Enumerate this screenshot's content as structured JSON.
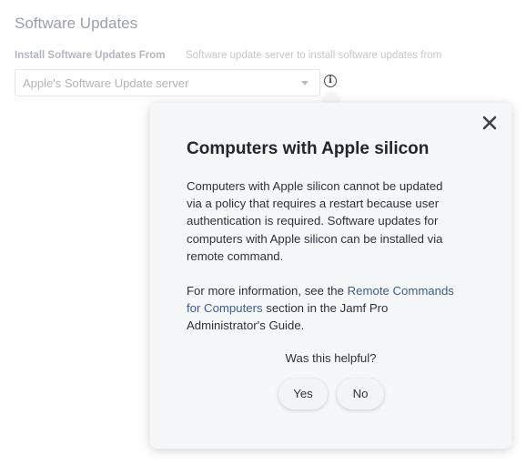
{
  "section": {
    "title": "Software Updates"
  },
  "field": {
    "label": "Install Software Updates From",
    "help": "Software update server to install software updates from",
    "selected_value": "Apple's Software Update server"
  },
  "icons": {
    "info": "info-icon",
    "close": "close-icon",
    "caret": "chevron-down-icon"
  },
  "popover": {
    "title": "Computers with Apple silicon",
    "body_lines": [
      "Computers with Apple silicon cannot be updated",
      "via a policy that requires a restart because user",
      "authentication is required. Software updates for",
      "computers with Apple silicon can be installed via",
      "remote command."
    ],
    "more_info": {
      "line1_prefix": "For more information, see the ",
      "link_line1": "Remote Commands",
      "link_line2": "for Computers",
      "line2_suffix": " section in the Jamf Pro",
      "line3": "Administrator's Guide."
    },
    "helpful_question": "Was this helpful?",
    "yes_label": "Yes",
    "no_label": "No"
  },
  "colors": {
    "link": "#3d5d86",
    "popover_bg": "#f6f7f9",
    "title_text": "#22272e"
  }
}
